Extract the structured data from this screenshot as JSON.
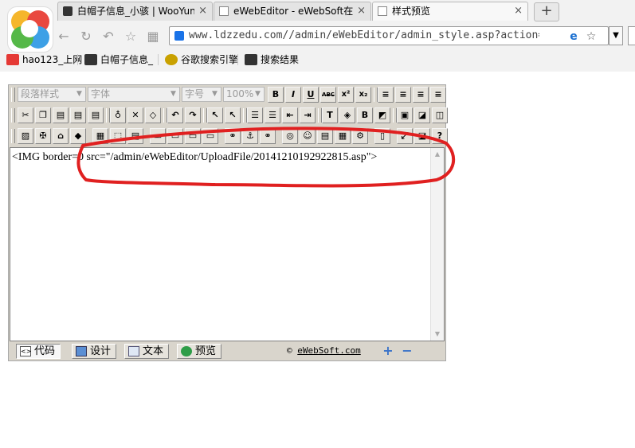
{
  "browser": {
    "tabs": [
      {
        "label": "白帽子信息_小骇 | WooYun",
        "close": "×"
      },
      {
        "label": "eWebEditor - eWebSoft在线",
        "close": "×"
      },
      {
        "label": "样式预览",
        "close": "×"
      }
    ],
    "new_tab": "+",
    "url": "www.ldzzedu.com//admin/eWebEditor/admin_style.asp?action=s",
    "bookmarks": [
      "hao123_上网",
      "白帽子信息_",
      "谷歌搜索引擎",
      "搜索结果"
    ]
  },
  "editor": {
    "selects": {
      "paragraph_style": "段落样式",
      "font": "字体",
      "font_size": "字号",
      "zoom": "100%"
    },
    "format_buttons": [
      "B",
      "I",
      "U",
      "ABC",
      "x²",
      "x₂"
    ],
    "content_text": "<IMG border=0 src=\"/admin/eWebEditor/UploadFile/20141210192922815.asp\">",
    "modes": [
      {
        "label": "代码",
        "active": true
      },
      {
        "label": "设计",
        "active": false
      },
      {
        "label": "文本",
        "active": false
      },
      {
        "label": "预览",
        "active": false
      }
    ],
    "copyright_symbol": "©",
    "copyright_link": "eWebSoft.com",
    "annotation_color": "#e02020"
  }
}
